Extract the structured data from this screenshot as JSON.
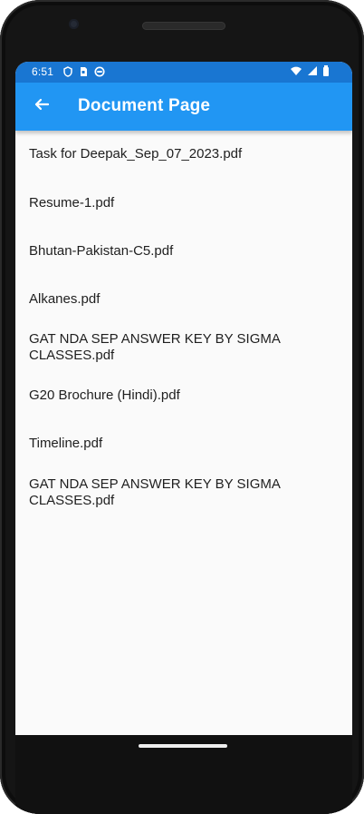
{
  "status_bar": {
    "time": "6:51",
    "icons_left": [
      "shield-icon",
      "sim-card-icon",
      "circle-status-icon"
    ],
    "icons_right": [
      "wifi-icon",
      "signal-icon",
      "battery-icon"
    ],
    "color": "#1976d2"
  },
  "app_bar": {
    "title": "Document Page",
    "back_icon": "back-arrow-icon",
    "color": "#2196f3"
  },
  "documents": [
    "Task for Deepak_Sep_07_2023.pdf",
    "Resume-1.pdf",
    "Bhutan-Pakistan-C5.pdf",
    "Alkanes.pdf",
    "GAT NDA SEP ANSWER KEY BY SIGMA CLASSES.pdf",
    "G20 Brochure (Hindi).pdf",
    "Timeline.pdf",
    "GAT NDA SEP ANSWER KEY BY SIGMA CLASSES.pdf"
  ],
  "colors": {
    "background": "#fafafa",
    "device_frame": "#151515",
    "text": "#1f1f1f"
  }
}
